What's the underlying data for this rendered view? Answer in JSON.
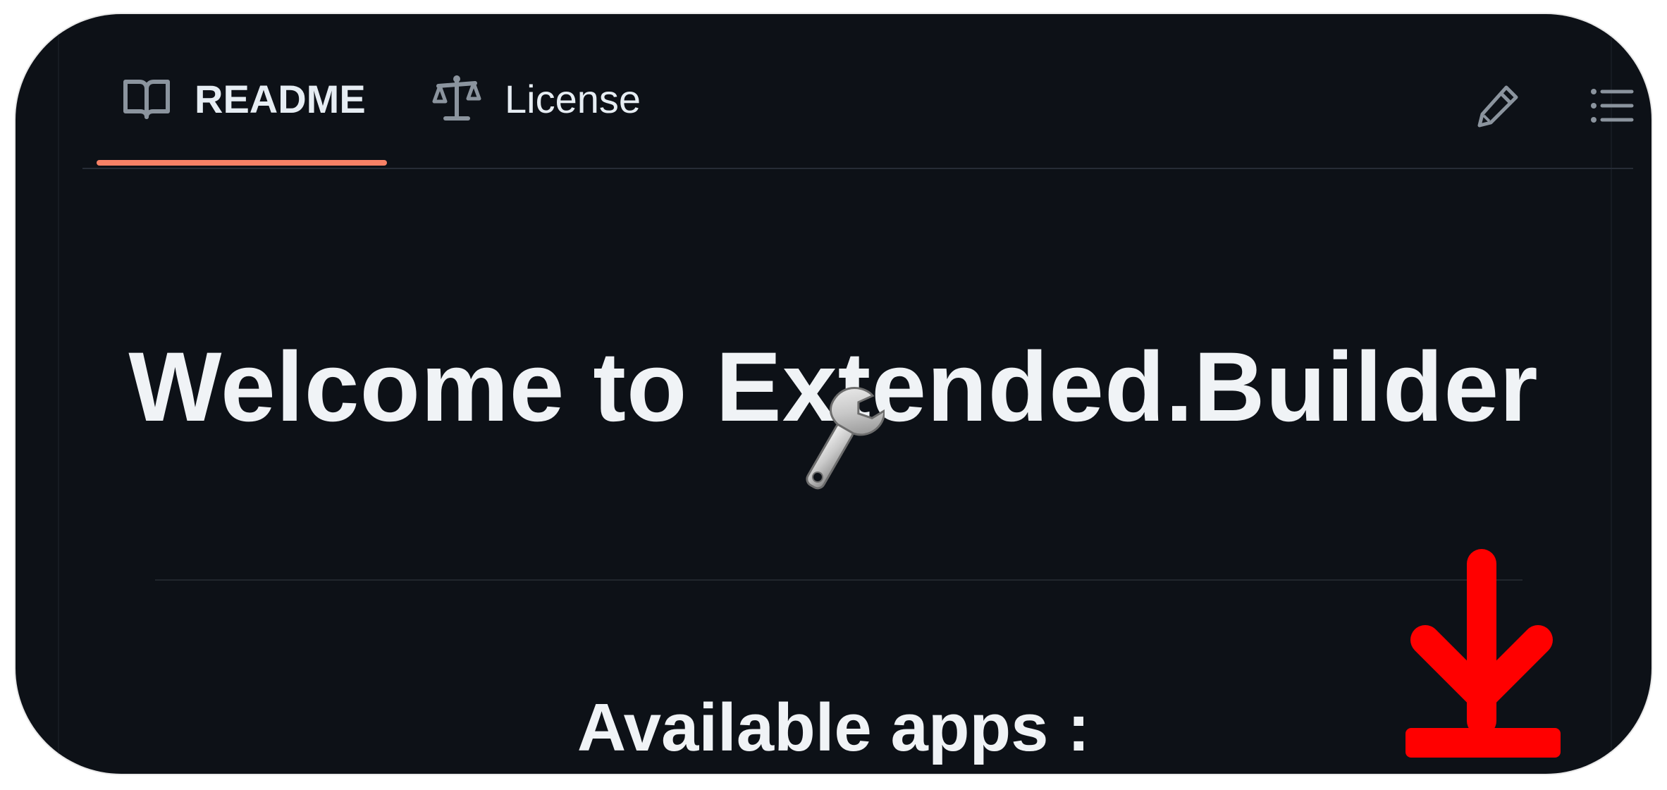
{
  "tabs": [
    {
      "label": "README",
      "icon": "book-icon",
      "active": true
    },
    {
      "label": "License",
      "icon": "law-icon",
      "active": false
    }
  ],
  "toolbar": {
    "edit_icon": "pencil-icon",
    "toc_icon": "list-icon"
  },
  "content": {
    "title": "Welcome to Extended.Builder",
    "title_icon": "wrench-icon",
    "subtitle": "Available apps :"
  },
  "overlay": {
    "download_icon": "download-arrow-icon"
  },
  "colors": {
    "background": "#0d1117",
    "text": "#e6edf3",
    "tab_underline": "#f78166",
    "download_arrow": "#ff0000"
  }
}
